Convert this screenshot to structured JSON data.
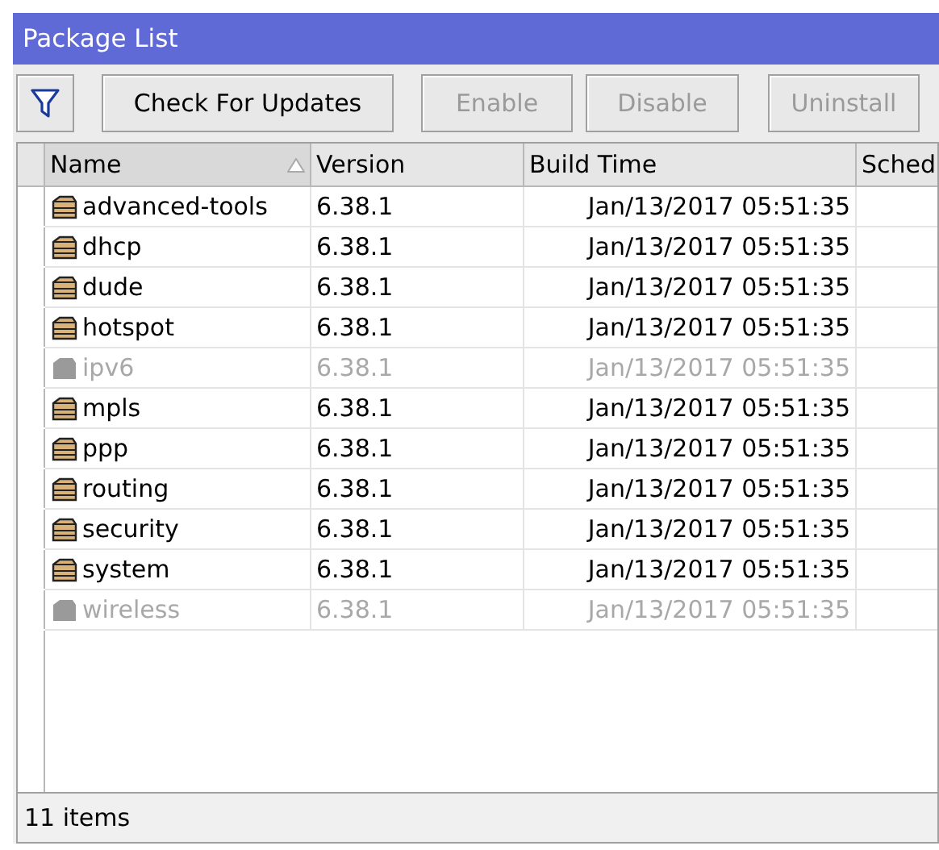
{
  "window": {
    "title": "Package List"
  },
  "toolbar": {
    "buttons": [
      {
        "kind": "filter",
        "disabled": false
      },
      {
        "kind": "text",
        "label": "Check For Updates",
        "disabled": false
      },
      {
        "kind": "text",
        "label": "Enable",
        "disabled": true
      },
      {
        "kind": "text",
        "label": "Disable",
        "disabled": true
      },
      {
        "kind": "text",
        "label": "Uninstall",
        "disabled": true
      }
    ]
  },
  "table": {
    "columns": [
      {
        "label": "Name",
        "sorted": true
      },
      {
        "label": "Version",
        "sorted": false
      },
      {
        "label": "Build Time",
        "sorted": false
      },
      {
        "label": "Sched",
        "sorted": false
      }
    ],
    "rows": [
      {
        "name": "advanced-tools",
        "version": "6.38.1",
        "build_time": "Jan/13/2017 05:51:35",
        "disabled": false
      },
      {
        "name": "dhcp",
        "version": "6.38.1",
        "build_time": "Jan/13/2017 05:51:35",
        "disabled": false
      },
      {
        "name": "dude",
        "version": "6.38.1",
        "build_time": "Jan/13/2017 05:51:35",
        "disabled": false
      },
      {
        "name": "hotspot",
        "version": "6.38.1",
        "build_time": "Jan/13/2017 05:51:35",
        "disabled": false
      },
      {
        "name": "ipv6",
        "version": "6.38.1",
        "build_time": "Jan/13/2017 05:51:35",
        "disabled": true
      },
      {
        "name": "mpls",
        "version": "6.38.1",
        "build_time": "Jan/13/2017 05:51:35",
        "disabled": false
      },
      {
        "name": "ppp",
        "version": "6.38.1",
        "build_time": "Jan/13/2017 05:51:35",
        "disabled": false
      },
      {
        "name": "routing",
        "version": "6.38.1",
        "build_time": "Jan/13/2017 05:51:35",
        "disabled": false
      },
      {
        "name": "security",
        "version": "6.38.1",
        "build_time": "Jan/13/2017 05:51:35",
        "disabled": false
      },
      {
        "name": "system",
        "version": "6.38.1",
        "build_time": "Jan/13/2017 05:51:35",
        "disabled": false
      },
      {
        "name": "wireless",
        "version": "6.38.1",
        "build_time": "Jan/13/2017 05:51:35",
        "disabled": true
      }
    ]
  },
  "status_bar": {
    "text": "11 items"
  }
}
